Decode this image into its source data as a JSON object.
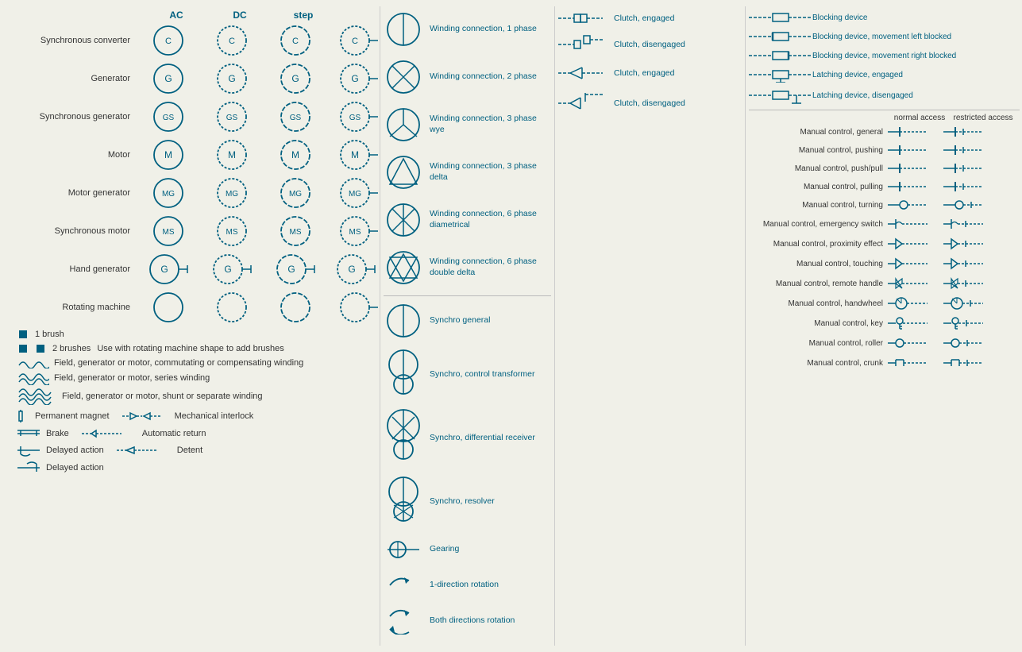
{
  "header": {
    "columns": [
      "AC",
      "DC",
      "step"
    ]
  },
  "machines": [
    {
      "label": "Synchronous converter",
      "symbol": "C"
    },
    {
      "label": "Generator",
      "symbol": "G"
    },
    {
      "label": "Synchronous generator",
      "symbol": "GS"
    },
    {
      "label": "Motor",
      "symbol": "M"
    },
    {
      "label": "Motor generator",
      "symbol": "MG"
    },
    {
      "label": "Synchronous motor",
      "symbol": "MS"
    },
    {
      "label": "Hand generator",
      "symbol": "G",
      "hasLines": true
    },
    {
      "label": "Rotating machine",
      "symbol": ""
    }
  ],
  "brushes": [
    {
      "label": "1 brush"
    },
    {
      "label": "2 brushes",
      "note": "Use with rotating machine shape to add brushes"
    }
  ],
  "windings": [
    {
      "label": "Field, generator or motor, commutating or compensating winding"
    },
    {
      "label": "Field, generator or motor, series winding"
    },
    {
      "label": "Field, generator or motor, shunt or separate winding"
    }
  ],
  "legend_items": [
    {
      "sym": "bracket",
      "label": "Permanent magnet",
      "sym2": "mech-interlock",
      "label2": "Mechanical interlock"
    },
    {
      "sym": "brake",
      "label": "Brake",
      "sym2": "auto-return",
      "label2": "Automatic return"
    },
    {
      "sym": "delayed1",
      "label": "Delayed action",
      "sym2": "detent",
      "label2": "Detent"
    },
    {
      "sym": "delayed2",
      "label": "Delayed action"
    }
  ],
  "winding_connections": [
    {
      "label": "Winding connection, 1 phase"
    },
    {
      "label": "Winding connection, 2 phase"
    },
    {
      "label": "Winding connection, 3 phase wye"
    },
    {
      "label": "Winding connection, 3 phase delta"
    },
    {
      "label": "Winding connection, 6 phase diametrical"
    },
    {
      "label": "Winding connection, 6 phase double delta"
    }
  ],
  "synchros": [
    {
      "label": "Synchro general"
    },
    {
      "label": "Synchro, control transformer"
    },
    {
      "label": "Synchro, differential receiver"
    },
    {
      "label": "Synchro, resolver"
    },
    {
      "label": "Gearing"
    },
    {
      "label": "1-direction rotation"
    },
    {
      "label": "Both directions rotation"
    }
  ],
  "clutches": [
    {
      "label": "Clutch, engaged"
    },
    {
      "label": "Clutch, disengaged"
    },
    {
      "label": "Clutch, engaged"
    },
    {
      "label": "Clutch, disengaged"
    }
  ],
  "blocking_devices": [
    {
      "label": "Blocking device"
    },
    {
      "label": "Blocking device, movement left blocked"
    },
    {
      "label": "Blocking device, movement right blocked"
    },
    {
      "label": "Latching device, engaged"
    },
    {
      "label": "Latching device, disengaged"
    }
  ],
  "manual_controls": [
    {
      "label": "Manual control, general"
    },
    {
      "label": "Manual control, pushing"
    },
    {
      "label": "Manual control, push/pull"
    },
    {
      "label": "Manual control, pulling"
    },
    {
      "label": "Manual control, turning"
    },
    {
      "label": "Manual control, emergency switch"
    },
    {
      "label": "Manual control, proximity effect"
    },
    {
      "label": "Manual control, touching"
    },
    {
      "label": "Manual control, remote handle"
    },
    {
      "label": "Manual control, handwheel"
    },
    {
      "label": "Manual control, key"
    },
    {
      "label": "Manual control, roller"
    },
    {
      "label": "Manual control, crunk"
    }
  ],
  "access_labels": {
    "normal": "normal access",
    "restricted": "restricted access"
  }
}
